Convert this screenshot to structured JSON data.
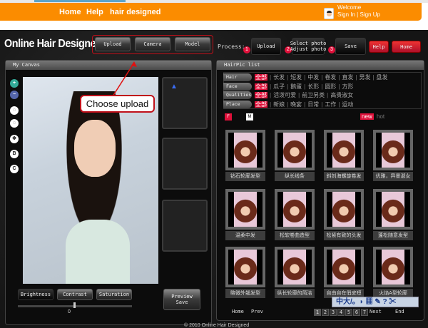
{
  "topnav": {
    "links": [
      "Home",
      "Help",
      "hair designed"
    ],
    "welcome": "Welcome",
    "sign_in": "Sign In",
    "sep": "|",
    "sign_up": "Sign Up"
  },
  "app": {
    "title": "Online Hair Designed",
    "source_buttons": [
      "Upload",
      "Camera",
      "Model"
    ],
    "process_label": "Process:",
    "steps": [
      {
        "num": "1",
        "label": "Upload"
      },
      {
        "num": "2",
        "label": "Select photo\nAdjust photo"
      },
      {
        "num": "3",
        "label": "Save"
      }
    ],
    "help": "Help",
    "home": "Home"
  },
  "callout": "Choose upload",
  "canvas": {
    "title": "My Canvas",
    "tools": [
      "zoom-in",
      "zoom-out",
      "rotate-left",
      "rotate-right",
      "move",
      "B",
      "C"
    ],
    "adjust": [
      "Brightness",
      "Contrast",
      "Saturation"
    ],
    "slider_value": "0",
    "preview_save": "Preview\nSave"
  },
  "hairpic": {
    "title": "HairPic list",
    "filters": [
      {
        "label": "Hair",
        "all": "全部",
        "options": [
          "长发",
          "短发",
          "中发",
          "卷发",
          "直发",
          "男发",
          "盘发"
        ]
      },
      {
        "label": "Face",
        "all": "全部",
        "options": [
          "瓜子",
          "鹅蛋",
          "长形",
          "圆形",
          "方形"
        ]
      },
      {
        "label": "Qualities",
        "all": "全部",
        "options": [
          "活泼可爱",
          "前卫另类",
          "高贵淑女"
        ]
      },
      {
        "label": "Place",
        "all": "全部",
        "options": [
          "新娘",
          "晚宴",
          "日常",
          "工作",
          "运动"
        ]
      }
    ],
    "gender": [
      "F",
      "M"
    ],
    "sort": [
      "new",
      "hot"
    ],
    "items": [
      "钻石轮廓发型",
      "纵长线条",
      "斜刘海螺旋卷发",
      "优雅，异墨淑女",
      "温柔中发",
      "松软卷曲造型",
      "松紧有致的头发",
      "蓬松随意发型",
      "略微外翘发型",
      "纵长轮廓的简洁",
      "自由自在俏皮短",
      "火焰A型轮廓"
    ],
    "pager": {
      "home": "Home",
      "prev": "Prev",
      "pages": [
        "1",
        "2",
        "3",
        "4",
        "5",
        "6",
        "7"
      ],
      "current": "1",
      "next": "Next",
      "end": "End"
    }
  },
  "ime_bar": "中大/。◗ ▦ ✎ ? ✂",
  "footer": "© 2010 Online Hair Designed"
}
